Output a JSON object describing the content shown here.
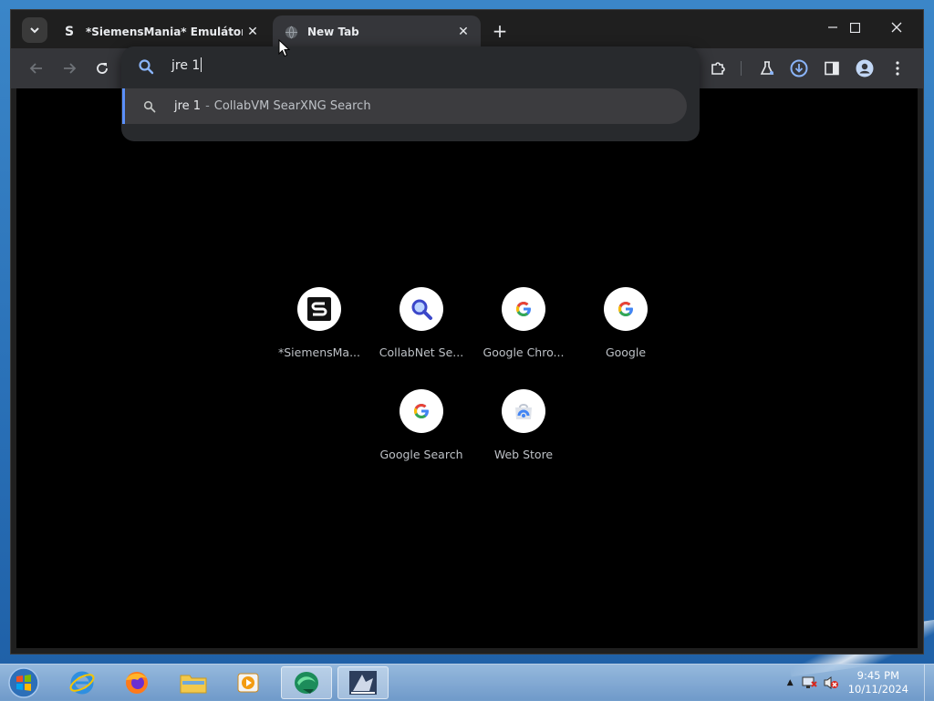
{
  "browser": {
    "tabs": [
      {
        "title": "*SiemensMania* Emulátory",
        "favicon_letter": "S",
        "active": false
      },
      {
        "title": "New Tab",
        "active": true
      }
    ],
    "new_tab_symbol": "+",
    "window_controls": {
      "minimize": "—",
      "maximize": "☐",
      "close": "✕"
    }
  },
  "omnibox": {
    "input_value": "jre 1",
    "suggestion": {
      "query": "jre 1",
      "separator": "-",
      "engine": "CollabVM SearXNG Search"
    }
  },
  "shortcuts": [
    {
      "label": "*SiemensMa...",
      "icon": "siemensmania-icon"
    },
    {
      "label": "CollabNet Se...",
      "icon": "magnifier-icon"
    },
    {
      "label": "Google Chro...",
      "icon": "google-g-icon"
    },
    {
      "label": "Google",
      "icon": "google-g-icon"
    },
    {
      "label": "Google Search",
      "icon": "google-g-icon"
    },
    {
      "label": "Web Store",
      "icon": "web-store-icon"
    }
  ],
  "taskbar": {
    "apps": [
      "internet-explorer-icon",
      "firefox-icon",
      "file-explorer-icon",
      "media-player-icon",
      "collabvm-app-icon",
      "siemens-app-icon"
    ],
    "clock": {
      "time": "9:45 PM",
      "date": "10/11/2024"
    }
  },
  "colors": {
    "accent_blue": "#5b8ff9",
    "tab_active": "#35363a",
    "page_bg": "#000000"
  }
}
